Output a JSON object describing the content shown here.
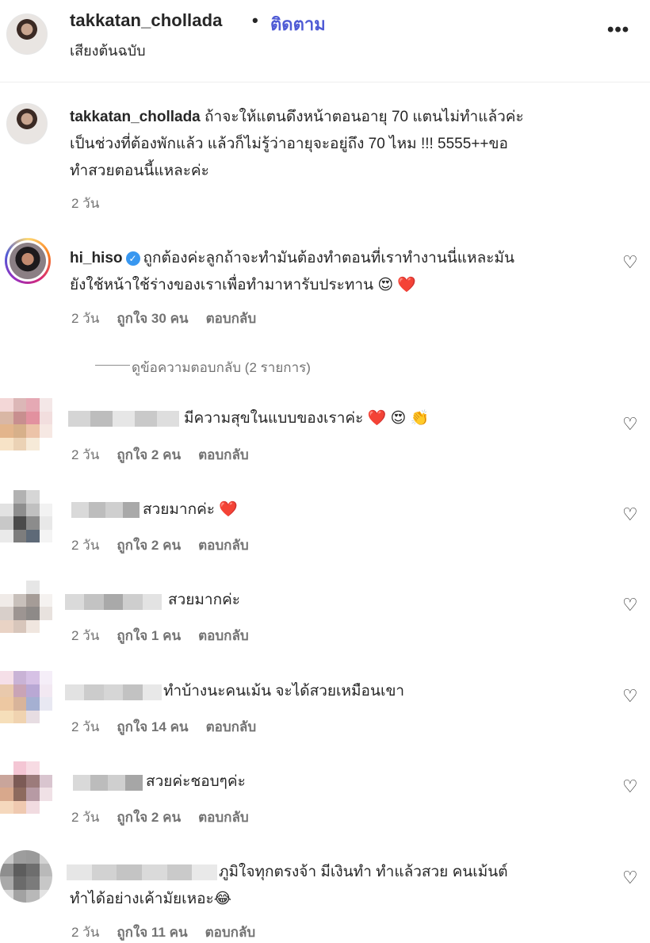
{
  "header": {
    "username": "takkatan_chollada",
    "dot": "•",
    "follow": "ติดตาม",
    "audio": "เสียงต้นฉบับ",
    "more": "•••"
  },
  "caption": {
    "username": "takkatan_chollada",
    "line1": "ถ้าจะให้แตนดึงหน้าตอนอายุ 70 แตนไม่ทำแล้วค่ะ",
    "line2": "เป็นช่วงที่ต้องพักแล้ว แล้วก็ไม่รู้ว่าอายุจะอยู่ถึง 70 ไหม !!! 5555++ขอ",
    "line3": "ทำสวยตอนนี้แหละค่ะ",
    "time": "2 วัน"
  },
  "comment_hiso": {
    "username": "hi_hiso",
    "line1": "ถูกต้องค่ะลูกถ้าจะทำมันต้องทำตอนที่เราทำงานนี่แหละมัน",
    "line2": "ยังใช้หน้าใช้ร่างของเราเพื่อทำมาหารับประทาน 😍 ❤️",
    "time": "2 วัน",
    "likes": "ถูกใจ 30 คน",
    "reply": "ตอบกลับ",
    "view_replies": "ดูข้อความตอบกลับ (2 รายการ)"
  },
  "comments": [
    {
      "text": "มีความสุขในแบบของเราค่ะ ❤️ 😍 👏",
      "time": "2 วัน",
      "likes": "ถูกใจ 2 คน",
      "reply": "ตอบกลับ"
    },
    {
      "text": "สวยมากค่ะ ❤️",
      "time": "2 วัน",
      "likes": "ถูกใจ 2 คน",
      "reply": "ตอบกลับ"
    },
    {
      "text": "สวยมากค่ะ",
      "time": "2 วัน",
      "likes": "ถูกใจ 1 คน",
      "reply": "ตอบกลับ"
    },
    {
      "text": "ทำบ้างนะคนเม้น จะได้สวยเหมือนเขา",
      "time": "2 วัน",
      "likes": "ถูกใจ 14 คน",
      "reply": "ตอบกลับ"
    },
    {
      "text": "สวยค่ะชอบๆค่ะ",
      "time": "2 วัน",
      "likes": "ถูกใจ 2 คน",
      "reply": "ตอบกลับ"
    },
    {
      "text": "ภูมิใจทุกตรงจ้า มีเงินทำ ทำแล้วสวย คนเม้นต์",
      "text2": "ทำได้อย่างเค้ามัยเหอะ😂",
      "time": "2 วัน",
      "likes": "ถูกใจ 11 คน",
      "reply": "ตอบกลับ"
    }
  ],
  "icons": {
    "heart": "♡",
    "check": "✓"
  },
  "colors": {
    "follow": "#4f5bd5",
    "meta": "#737373",
    "verified": "#3897f0"
  }
}
